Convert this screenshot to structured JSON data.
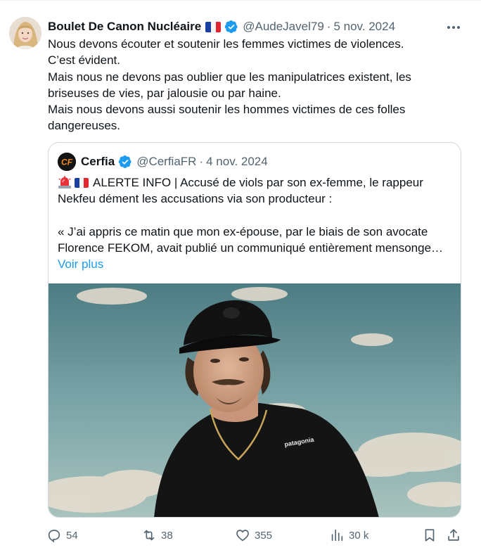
{
  "tweet": {
    "author_name": "Boulet De Canon Nucléaire",
    "handle": "@AudeJavel79",
    "separator": "·",
    "date": "5 nov. 2024",
    "more_label": "···",
    "body": [
      "Nous devons écouter et soutenir les femmes victimes de violences.",
      "C’est évident.",
      "Mais nous ne devons pas oublier que les manipulatrices existent, les briseuses de vies, par jalousie ou par haine.",
      "Mais nous devons aussi soutenir les hommes victimes de ces folles dangereuses."
    ]
  },
  "quoted": {
    "author_name": "Cerfia",
    "handle": "@CerfiaFR",
    "separator": "·",
    "date": "4 nov. 2024",
    "line1": "ALERTE INFO | Accusé de viols par son ex-femme, le rappeur Nekfeu dément les accusations via son producteur :",
    "line2": "« J’ai appris ce matin que mon ex-épouse, par le biais de son avocate Florence FEKOM, avait publié un communiqué entièrement mensonge…",
    "show_more": "Voir plus",
    "image_shirt_text": "patagonia"
  },
  "actions": {
    "replies": "54",
    "reposts": "38",
    "likes": "355",
    "views": "30 k"
  },
  "colors": {
    "text": "#0f1419",
    "secondary": "#536471",
    "link": "#1d9bf0",
    "verified": "#1d9bf0",
    "border": "#cfd9de"
  },
  "icons": [
    "more-icon",
    "verified-icon",
    "french-flag-icon",
    "rotating-light-icon",
    "reply-icon",
    "repost-icon",
    "like-icon",
    "views-icon",
    "bookmark-icon",
    "share-icon"
  ]
}
